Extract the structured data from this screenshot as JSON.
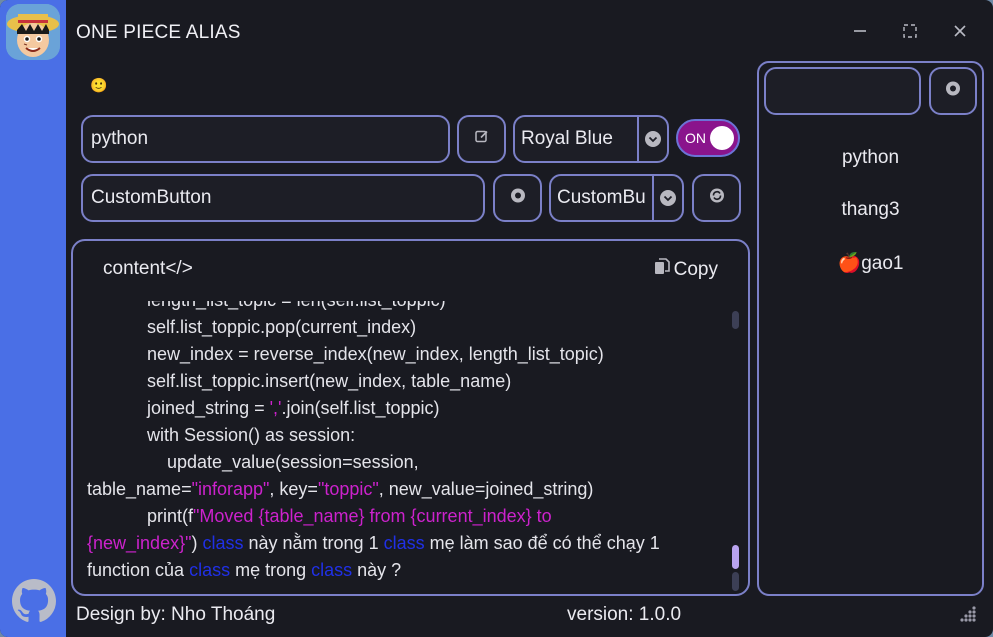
{
  "window": {
    "title": "ONE PIECE ALIAS"
  },
  "icons": {
    "avatar": "luffy-avatar",
    "github": "github-icon",
    "minimize": "minimize-icon",
    "maximize": "maximize-icon",
    "close": "close-icon",
    "emoji": "smiley-emoji-icon"
  },
  "emoji_text": "🙂",
  "row1": {
    "alias_value": "python",
    "edit_icon": "edit-icon",
    "theme_value": "Royal Blue",
    "toggle_label": "ON"
  },
  "row2": {
    "class_value": "CustomButton",
    "add_icon": "record-icon",
    "combo_value": "CustomBu",
    "refresh_icon": "refresh-icon"
  },
  "content": {
    "header": "content</>",
    "copy_label": "Copy",
    "lines": [
      "            length_list_topic = len(self.list_toppic)",
      "            self.list_toppic.pop(current_index)",
      "            new_index = reverse_index(new_index, length_list_topic)",
      "            self.list_toppic.insert(new_index, table_name)",
      "            joined_string = ','.join(self.list_toppic)",
      "            with Session() as session:",
      "                update_value(session=session,",
      "table_name=\"inforapp\", key=\"toppic\", new_value=joined_string)",
      "            print(f\"Moved {table_name} from {current_index} to",
      "{new_index}\") class này nằm trong 1 class mẹ làm sao để có thể chạy 1",
      "function của class mẹ trong class này ?"
    ]
  },
  "right_panel": {
    "search_value": "",
    "search_icon": "record-icon",
    "items": [
      "python",
      "thang3",
      "gao1"
    ],
    "item3_emoji": "🍎"
  },
  "footer": {
    "design_by": "Design by: Nho Thoáng",
    "version": "version: 1.0.0"
  },
  "colors": {
    "background": "#191a21",
    "sidebar": "#4a6fe6",
    "border": "#7b80c8",
    "toggle_on": "#8a148c",
    "string": "#cc22cc",
    "keyword": "#2030e6"
  }
}
